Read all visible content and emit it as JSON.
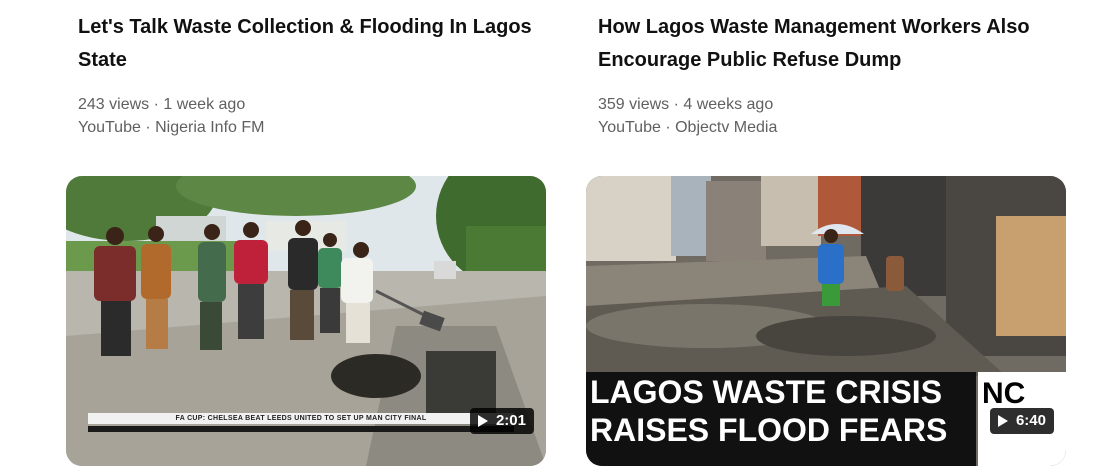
{
  "cards": [
    {
      "title": "Let's Talk Waste Collection & Flooding In Lagos State",
      "views": "243 views",
      "age": "1 week ago",
      "source": "YouTube",
      "channel": "Nigeria Info FM",
      "duration": "2:01",
      "ticker_text": "FA CUP: CHELSEA BEAT LEEDS UNITED TO SET UP MAN CITY FINAL"
    },
    {
      "title": "How Lagos Waste Management Workers Also Encourage Public Refuse Dump",
      "views": "359 views",
      "age": "4 weeks ago",
      "source": "YouTube",
      "channel": "Objectv Media",
      "duration": "6:40",
      "headline_line1": "LAGOS WASTE CRISIS",
      "headline_line2": "RAISES FLOOD FEARS",
      "channel_tag": "NC"
    }
  ],
  "separator": " · ",
  "icons": {
    "play": "play-icon"
  },
  "colors": {
    "title": "#111111",
    "meta": "#606060",
    "badge_bg": "#000000"
  }
}
